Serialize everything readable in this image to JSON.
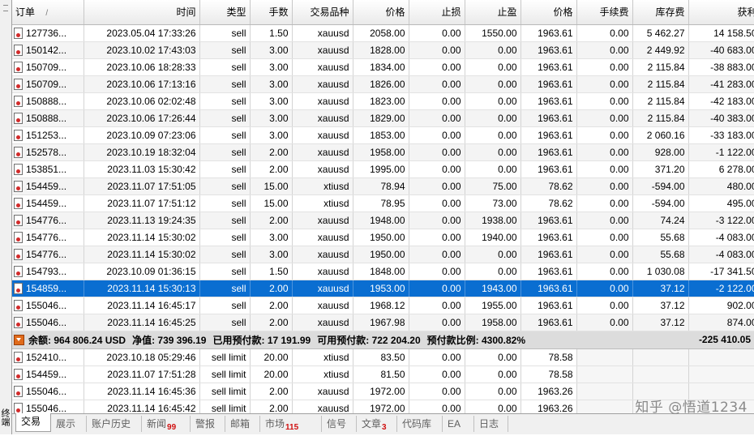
{
  "side_panel": {
    "label": "终端"
  },
  "columns": [
    {
      "label": "订单",
      "sort": "/",
      "align": "left"
    },
    {
      "label": "时间"
    },
    {
      "label": "类型"
    },
    {
      "label": "手数"
    },
    {
      "label": "交易品种"
    },
    {
      "label": "价格"
    },
    {
      "label": "止损"
    },
    {
      "label": "止盈"
    },
    {
      "label": "价格"
    },
    {
      "label": "手续费"
    },
    {
      "label": "库存费"
    },
    {
      "label": "获利"
    }
  ],
  "close_glyph": "×",
  "orders": [
    {
      "ticket": "127736...",
      "time": "2023.05.04 17:33:26",
      "type": "sell",
      "lots": "1.50",
      "symbol": "xauusd",
      "price": "2058.00",
      "sl": "0.00",
      "tp": "1550.00",
      "current": "1963.61",
      "commission": "0.00",
      "swap": "5 462.27",
      "profit": "14 158.50"
    },
    {
      "ticket": "150142...",
      "time": "2023.10.02 17:43:03",
      "type": "sell",
      "lots": "3.00",
      "symbol": "xauusd",
      "price": "1828.00",
      "sl": "0.00",
      "tp": "0.00",
      "current": "1963.61",
      "commission": "0.00",
      "swap": "2 449.92",
      "profit": "-40 683.00"
    },
    {
      "ticket": "150709...",
      "time": "2023.10.06 18:28:33",
      "type": "sell",
      "lots": "3.00",
      "symbol": "xauusd",
      "price": "1834.00",
      "sl": "0.00",
      "tp": "0.00",
      "current": "1963.61",
      "commission": "0.00",
      "swap": "2 115.84",
      "profit": "-38 883.00"
    },
    {
      "ticket": "150709...",
      "time": "2023.10.06 17:13:16",
      "type": "sell",
      "lots": "3.00",
      "symbol": "xauusd",
      "price": "1826.00",
      "sl": "0.00",
      "tp": "0.00",
      "current": "1963.61",
      "commission": "0.00",
      "swap": "2 115.84",
      "profit": "-41 283.00"
    },
    {
      "ticket": "150888...",
      "time": "2023.10.06 02:02:48",
      "type": "sell",
      "lots": "3.00",
      "symbol": "xauusd",
      "price": "1823.00",
      "sl": "0.00",
      "tp": "0.00",
      "current": "1963.61",
      "commission": "0.00",
      "swap": "2 115.84",
      "profit": "-42 183.00"
    },
    {
      "ticket": "150888...",
      "time": "2023.10.06 17:26:44",
      "type": "sell",
      "lots": "3.00",
      "symbol": "xauusd",
      "price": "1829.00",
      "sl": "0.00",
      "tp": "0.00",
      "current": "1963.61",
      "commission": "0.00",
      "swap": "2 115.84",
      "profit": "-40 383.00"
    },
    {
      "ticket": "151253...",
      "time": "2023.10.09 07:23:06",
      "type": "sell",
      "lots": "3.00",
      "symbol": "xauusd",
      "price": "1853.00",
      "sl": "0.00",
      "tp": "0.00",
      "current": "1963.61",
      "commission": "0.00",
      "swap": "2 060.16",
      "profit": "-33 183.00"
    },
    {
      "ticket": "152578...",
      "time": "2023.10.19 18:32:04",
      "type": "sell",
      "lots": "2.00",
      "symbol": "xauusd",
      "price": "1958.00",
      "sl": "0.00",
      "tp": "0.00",
      "current": "1963.61",
      "commission": "0.00",
      "swap": "928.00",
      "profit": "-1 122.00"
    },
    {
      "ticket": "153851...",
      "time": "2023.11.03 15:30:42",
      "type": "sell",
      "lots": "2.00",
      "symbol": "xauusd",
      "price": "1995.00",
      "sl": "0.00",
      "tp": "0.00",
      "current": "1963.61",
      "commission": "0.00",
      "swap": "371.20",
      "profit": "6 278.00"
    },
    {
      "ticket": "154459...",
      "time": "2023.11.07 17:51:05",
      "type": "sell",
      "lots": "15.00",
      "symbol": "xtiusd",
      "price": "78.94",
      "sl": "0.00",
      "tp": "75.00",
      "current": "78.62",
      "commission": "0.00",
      "swap": "-594.00",
      "profit": "480.00"
    },
    {
      "ticket": "154459...",
      "time": "2023.11.07 17:51:12",
      "type": "sell",
      "lots": "15.00",
      "symbol": "xtiusd",
      "price": "78.95",
      "sl": "0.00",
      "tp": "73.00",
      "current": "78.62",
      "commission": "0.00",
      "swap": "-594.00",
      "profit": "495.00"
    },
    {
      "ticket": "154776...",
      "time": "2023.11.13 19:24:35",
      "type": "sell",
      "lots": "2.00",
      "symbol": "xauusd",
      "price": "1948.00",
      "sl": "0.00",
      "tp": "1938.00",
      "current": "1963.61",
      "commission": "0.00",
      "swap": "74.24",
      "profit": "-3 122.00"
    },
    {
      "ticket": "154776...",
      "time": "2023.11.14 15:30:02",
      "type": "sell",
      "lots": "3.00",
      "symbol": "xauusd",
      "price": "1950.00",
      "sl": "0.00",
      "tp": "1940.00",
      "current": "1963.61",
      "commission": "0.00",
      "swap": "55.68",
      "profit": "-4 083.00"
    },
    {
      "ticket": "154776...",
      "time": "2023.11.14 15:30:02",
      "type": "sell",
      "lots": "3.00",
      "symbol": "xauusd",
      "price": "1950.00",
      "sl": "0.00",
      "tp": "0.00",
      "current": "1963.61",
      "commission": "0.00",
      "swap": "55.68",
      "profit": "-4 083.00"
    },
    {
      "ticket": "154793...",
      "time": "2023.10.09 01:36:15",
      "type": "sell",
      "lots": "1.50",
      "symbol": "xauusd",
      "price": "1848.00",
      "sl": "0.00",
      "tp": "0.00",
      "current": "1963.61",
      "commission": "0.00",
      "swap": "1 030.08",
      "profit": "-17 341.50"
    },
    {
      "ticket": "154859...",
      "time": "2023.11.14 15:30:13",
      "type": "sell",
      "lots": "2.00",
      "symbol": "xauusd",
      "price": "1953.00",
      "sl": "0.00",
      "tp": "1943.00",
      "current": "1963.61",
      "commission": "0.00",
      "swap": "37.12",
      "profit": "-2 122.00",
      "selected": true
    },
    {
      "ticket": "155046...",
      "time": "2023.11.14 16:45:17",
      "type": "sell",
      "lots": "2.00",
      "symbol": "xauusd",
      "price": "1968.12",
      "sl": "0.00",
      "tp": "1955.00",
      "current": "1963.61",
      "commission": "0.00",
      "swap": "37.12",
      "profit": "902.00"
    },
    {
      "ticket": "155046...",
      "time": "2023.11.14 16:45:25",
      "type": "sell",
      "lots": "2.00",
      "symbol": "xauusd",
      "price": "1967.98",
      "sl": "0.00",
      "tp": "1958.00",
      "current": "1963.61",
      "commission": "0.00",
      "swap": "37.12",
      "profit": "874.00"
    }
  ],
  "summary": {
    "balance_label": "余额:",
    "balance": "964 806.24 USD",
    "equity_label": "净值:",
    "equity": "739 396.19",
    "margin_label": "已用预付款:",
    "margin": "17 191.99",
    "free_margin_label": "可用预付款:",
    "free_margin": "722 204.20",
    "margin_level_label": "预付款比例:",
    "margin_level": "4300.82%",
    "total_profit": "-225 410.05"
  },
  "pending_orders": [
    {
      "ticket": "152410...",
      "time": "2023.10.18 05:29:46",
      "type": "sell limit",
      "lots": "20.00",
      "symbol": "xtiusd",
      "price": "83.50",
      "sl": "0.00",
      "tp": "0.00",
      "current": "78.58"
    },
    {
      "ticket": "154459...",
      "time": "2023.11.07 17:51:28",
      "type": "sell limit",
      "lots": "20.00",
      "symbol": "xtiusd",
      "price": "81.50",
      "sl": "0.00",
      "tp": "0.00",
      "current": "78.58"
    },
    {
      "ticket": "155046...",
      "time": "2023.11.14 16:45:36",
      "type": "sell limit",
      "lots": "2.00",
      "symbol": "xauusd",
      "price": "1972.00",
      "sl": "0.00",
      "tp": "0.00",
      "current": "1963.26"
    },
    {
      "ticket": "155046...",
      "time": "2023.11.14 16:45:42",
      "type": "sell limit",
      "lots": "2.00",
      "symbol": "xauusd",
      "price": "1972.00",
      "sl": "0.00",
      "tp": "0.00",
      "current": "1963.26"
    }
  ],
  "tabs": [
    {
      "label": "交易",
      "active": true
    },
    {
      "label": "展示"
    },
    {
      "label": "账户历史"
    },
    {
      "label": "新闻",
      "badge": "99"
    },
    {
      "label": "警报"
    },
    {
      "label": "邮箱"
    },
    {
      "label": "市场",
      "badge": "115"
    },
    {
      "label": "信号"
    },
    {
      "label": "文章",
      "badge": "3"
    },
    {
      "label": "代码库"
    },
    {
      "label": "EA"
    },
    {
      "label": "日志"
    }
  ],
  "watermark": "知乎 @悟道1234"
}
